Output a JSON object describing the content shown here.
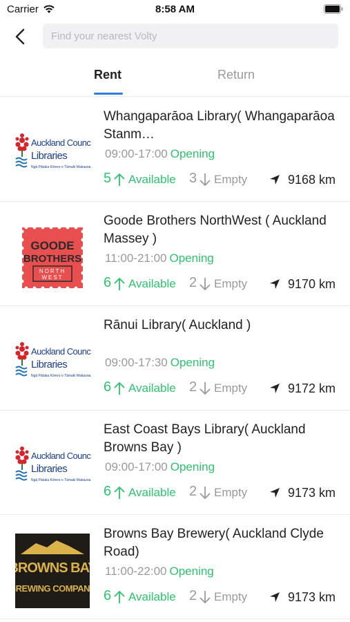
{
  "status_bar": {
    "carrier": "Carrier",
    "time": "8:58 AM"
  },
  "search": {
    "placeholder": "Find your nearest Volty",
    "value": ""
  },
  "tabs": [
    {
      "label": "Rent",
      "active": true
    },
    {
      "label": "Return",
      "active": false
    }
  ],
  "colors": {
    "accent": "#2f7de1",
    "available": "#2cc46e",
    "muted": "#9a9a9a"
  },
  "stations": [
    {
      "name": "Whangaparāoa Library( Whangaparāoa Stanm…",
      "hours": "09:00-17:00",
      "status": "Opening",
      "available": "5",
      "available_label": "Available",
      "empty": "3",
      "empty_label": "Empty",
      "distance": "9168 km",
      "logo": "auckland-council-libraries",
      "logo_lines": [
        "Auckland Council",
        "Libraries",
        "Ngā Pātaka Kōrero o Tāmaki Makaurau"
      ]
    },
    {
      "name": "Goode Brothers NorthWest ( Auckland Massey )",
      "hours": "11:00-21:00",
      "status": "Opening",
      "available": "6",
      "available_label": "Available",
      "empty": "2",
      "empty_label": "Empty",
      "distance": "9170 km",
      "logo": "goode-brothers-northwest",
      "logo_lines": [
        "GOODE",
        "BROTHERS",
        "NORTH",
        "WEST"
      ]
    },
    {
      "name": "Rānui Library( Auckland  )",
      "hours": "09:00-17:30",
      "status": "Opening",
      "available": "6",
      "available_label": "Available",
      "empty": "2",
      "empty_label": "Empty",
      "distance": "9172 km",
      "logo": "auckland-council-libraries",
      "logo_lines": [
        "Auckland Council",
        "Libraries",
        "Ngā Pātaka Kōrero o Tāmaki Makaurau"
      ]
    },
    {
      "name": "East Coast Bays Library( Auckland Browns Bay )",
      "hours": "09:00-17:00",
      "status": "Opening",
      "available": "6",
      "available_label": "Available",
      "empty": "2",
      "empty_label": "Empty",
      "distance": "9173 km",
      "logo": "auckland-council-libraries",
      "logo_lines": [
        "Auckland Council",
        "Libraries",
        "Ngā Pātaka Kōrero o Tāmaki Makaurau"
      ]
    },
    {
      "name": "Browns Bay Brewery( Auckland Clyde Road)",
      "hours": "11:00-22:00",
      "status": "Opening",
      "available": "6",
      "available_label": "Available",
      "empty": "2",
      "empty_label": "Empty",
      "distance": "9173 km",
      "logo": "browns-bay-brewing-company",
      "logo_lines": [
        "BROWNS BAY",
        "BREWING COMPANY"
      ]
    }
  ]
}
